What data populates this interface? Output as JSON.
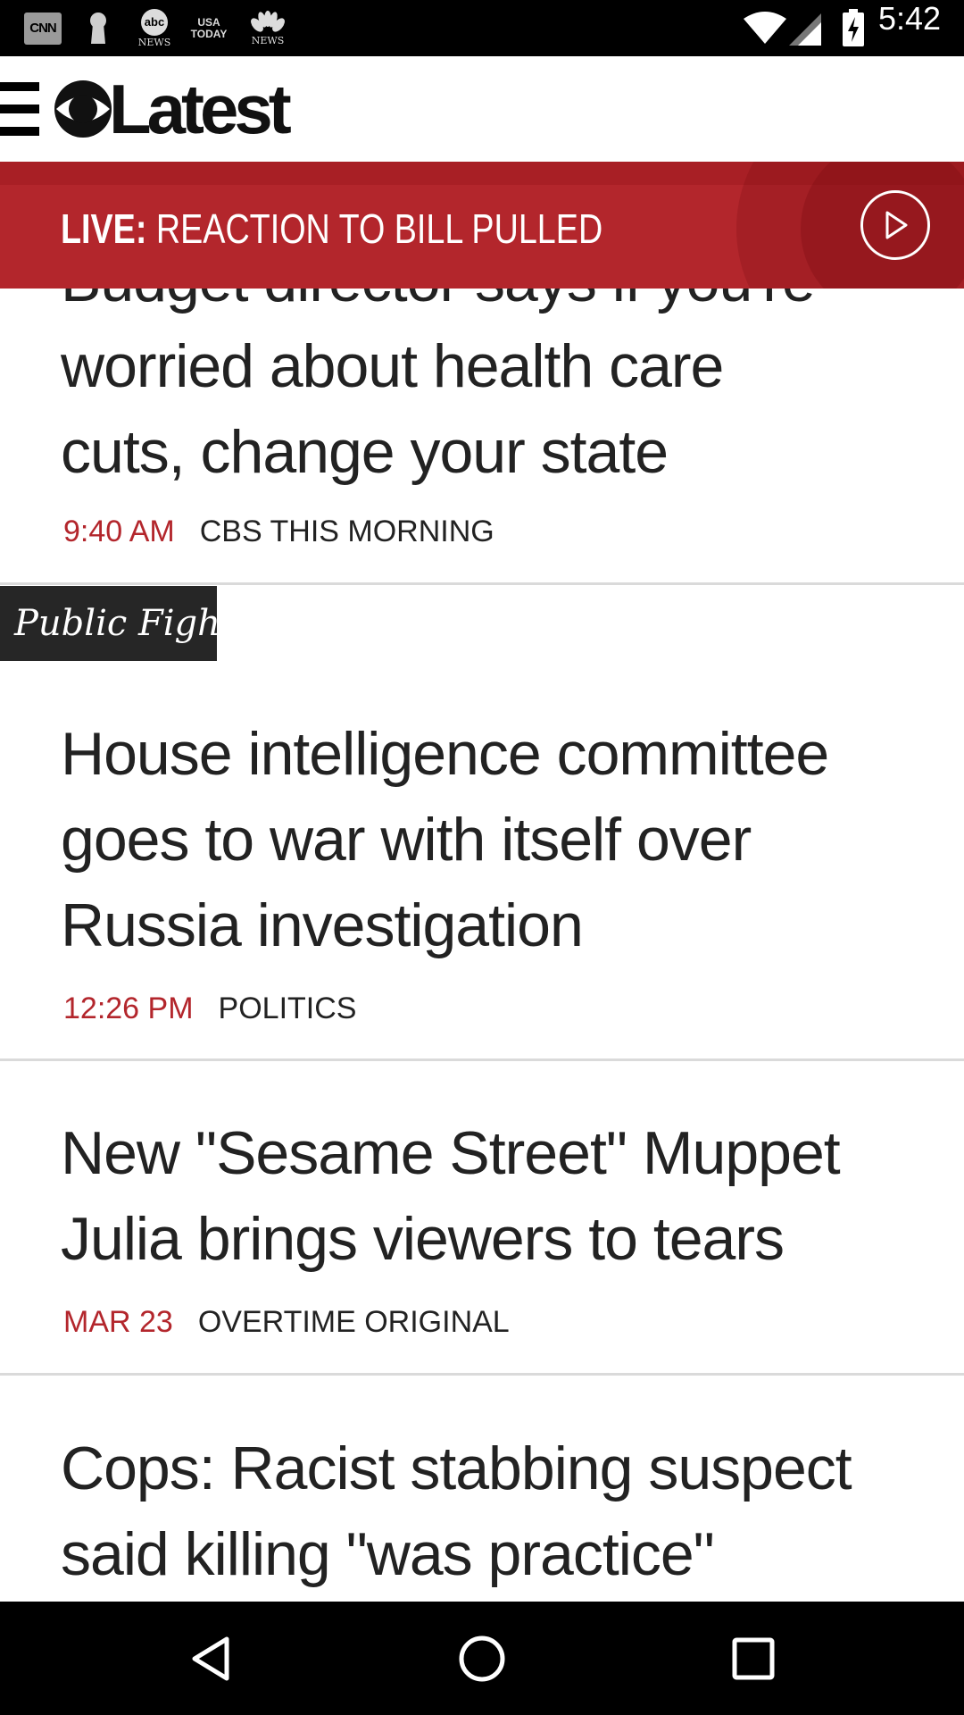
{
  "status_bar": {
    "time": "5:42",
    "notifications": [
      {
        "name": "cnn-icon",
        "label": "CNN"
      },
      {
        "name": "keyhole-icon",
        "label": ""
      },
      {
        "name": "abc-news-icon",
        "label": "abc",
        "sub": "NEWS"
      },
      {
        "name": "usa-today-icon",
        "line1": "USA",
        "line2": "TODAY"
      },
      {
        "name": "nbc-news-icon",
        "sub": "NEWS"
      }
    ]
  },
  "app_bar": {
    "logo_text": "Latest"
  },
  "live_banner": {
    "prefix": "LIVE:",
    "title": "REACTION TO BILL PULLED"
  },
  "stories": [
    {
      "headline_hidden_line": "Budget director says if you're",
      "headline_lines": [
        "worried about health care",
        "cuts, change your state"
      ],
      "time": "9:40 AM",
      "section": "CBS THIS MORNING"
    },
    {
      "tag": "Public Fight",
      "headline_lines": [
        "House intelligence committee",
        "goes to war with itself over",
        "Russia investigation"
      ],
      "time": "12:26 PM",
      "section": "POLITICS"
    },
    {
      "headline_lines": [
        "New \"Sesame Street\" Muppet",
        "Julia brings viewers to tears"
      ],
      "time": "MAR 23",
      "section": "OVERTIME ORIGINAL"
    },
    {
      "headline_lines": [
        "Cops: Racist stabbing suspect",
        "said killing \"was practice\""
      ]
    }
  ],
  "colors": {
    "accent": "#b3262c",
    "tag_bg": "#262626"
  }
}
